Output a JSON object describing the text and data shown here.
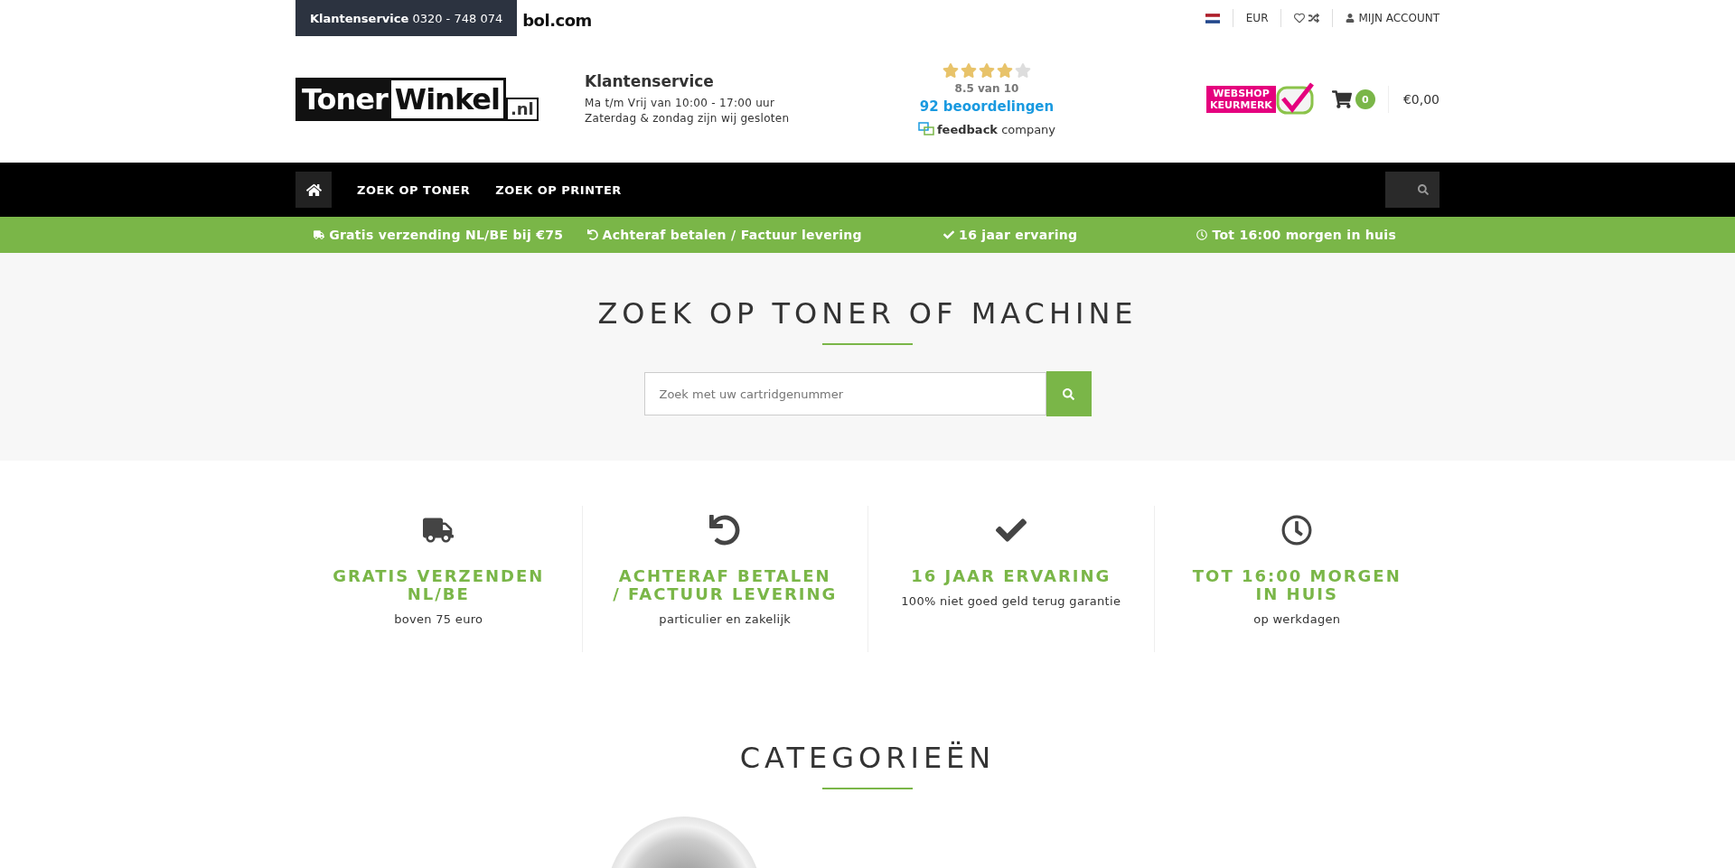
{
  "topbar": {
    "service_label": "Klantenservice",
    "service_phone": "0320 - 748 074",
    "partner_logo": "bol.com",
    "currency": "EUR",
    "account": "MIJN ACCOUNT"
  },
  "header": {
    "logo_part1": "Toner",
    "logo_part2": "Winkel",
    "logo_suffix": ".nl",
    "service_title": "Klantenservice",
    "service_hours": "Ma t/m Vrij van 10:00 - 17:00 uur",
    "service_weekend": "Zaterdag & zondag zijn wij gesloten",
    "rating": {
      "stars": 4,
      "score": "8.5 van 10",
      "reviews": "92 beoordelingen",
      "provider": "feedback",
      "provider_suffix": "company"
    },
    "keurmerk": {
      "line1": "WEBSHOP",
      "line2": "KEURMERK"
    },
    "cart": {
      "count": "0",
      "total": "€0,00"
    }
  },
  "nav": {
    "items": [
      {
        "label": "ZOEK OP TONER"
      },
      {
        "label": "ZOEK OP PRINTER"
      }
    ]
  },
  "usp_bar": [
    {
      "kind": "truck",
      "text": "Gratis verzending NL/BE bij €75"
    },
    {
      "kind": "undo",
      "text": "Achteraf betalen / Factuur levering"
    },
    {
      "kind": "check",
      "text": "16 jaar ervaring"
    },
    {
      "kind": "clock",
      "text": "Tot 16:00 morgen in huis"
    }
  ],
  "hero": {
    "title": "ZOEK OP TONER OF MACHINE",
    "placeholder": "Zoek met uw cartridgenummer"
  },
  "features": [
    {
      "kind": "truck",
      "title": "GRATIS VERZENDEN NL/BE",
      "text": "boven 75 euro"
    },
    {
      "kind": "undo",
      "title": "ACHTERAF BETALEN / FACTUUR LEVERING",
      "text": "particulier en zakelijk"
    },
    {
      "kind": "check",
      "title": "16 JAAR ERVARING",
      "text": "100% niet goed geld terug garantie"
    },
    {
      "kind": "clock",
      "title": "TOT 16:00 MORGEN IN HUIS",
      "text": "op werkdagen"
    }
  ],
  "categories": {
    "title": "CATEGORIEËN"
  }
}
